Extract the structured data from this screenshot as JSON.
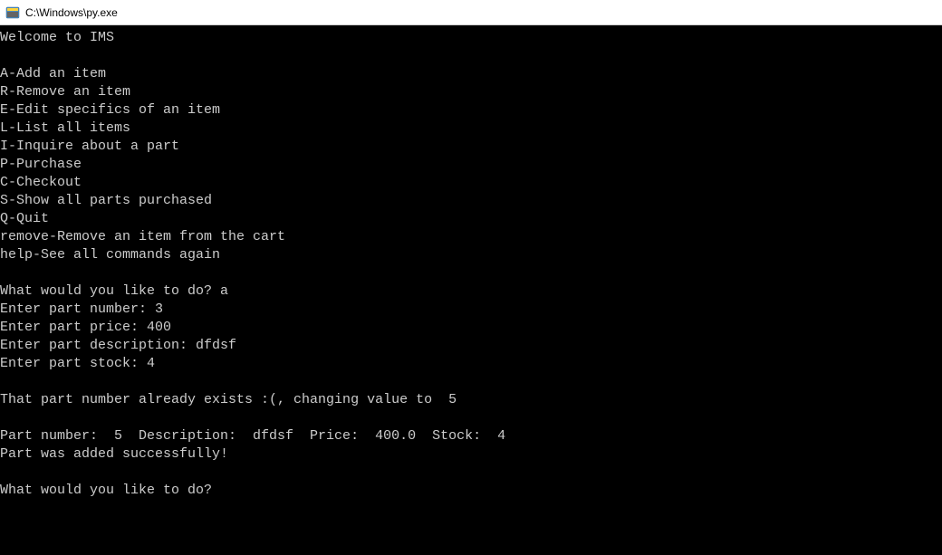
{
  "titlebar": {
    "title": "C:\\Windows\\py.exe"
  },
  "terminal": {
    "lines": [
      "Welcome to IMS",
      "",
      "A-Add an item",
      "R-Remove an item",
      "E-Edit specifics of an item",
      "L-List all items",
      "I-Inquire about a part",
      "P-Purchase",
      "C-Checkout",
      "S-Show all parts purchased",
      "Q-Quit",
      "remove-Remove an item from the cart",
      "help-See all commands again",
      "",
      "What would you like to do? a",
      "Enter part number: 3",
      "Enter part price: 400",
      "Enter part description: dfdsf",
      "Enter part stock: 4",
      "",
      "That part number already exists :(, changing value to  5",
      "",
      "Part number:  5  Description:  dfdsf  Price:  400.0  Stock:  4",
      "Part was added successfully!",
      "",
      "What would you like to do?"
    ]
  }
}
